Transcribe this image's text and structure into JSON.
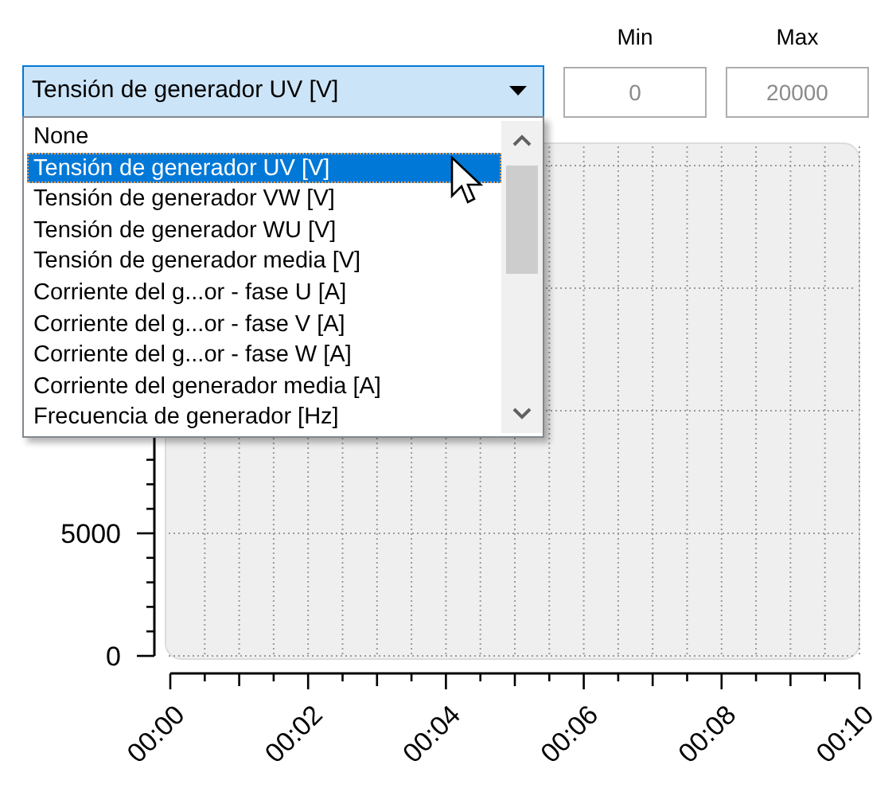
{
  "combobox": {
    "value": "Tensión de generador UV [V]",
    "expanded": true
  },
  "min": {
    "label": "Min",
    "value": "0",
    "disabled": true
  },
  "max": {
    "label": "Max",
    "value": "20000",
    "disabled": true
  },
  "dropdown_items": [
    {
      "label": "None",
      "selected": false
    },
    {
      "label": "Tensión de generador UV [V]",
      "selected": true
    },
    {
      "label": "Tensión de generador VW [V]",
      "selected": false
    },
    {
      "label": "Tensión de generador WU [V]",
      "selected": false
    },
    {
      "label": "Tensión de generador media [V]",
      "selected": false
    },
    {
      "label": "Corriente del g...or - fase U [A]",
      "selected": false
    },
    {
      "label": "Corriente del g...or - fase V [A]",
      "selected": false
    },
    {
      "label": "Corriente del g...or - fase W [A]",
      "selected": false
    },
    {
      "label": "Corriente del generador media [A]",
      "selected": false
    },
    {
      "label": "Frecuencia de generador [Hz]",
      "selected": false
    }
  ],
  "chart_data": {
    "type": "line",
    "grid": true,
    "ylim": [
      0,
      20000
    ],
    "yticks": [
      0,
      5000
    ],
    "xlim": [
      0,
      10
    ],
    "xticks": [
      {
        "value": 0,
        "label": "00:00"
      },
      {
        "value": 2,
        "label": "00:02"
      },
      {
        "value": 4,
        "label": "00:04"
      },
      {
        "value": 6,
        "label": "00:06"
      },
      {
        "value": 8,
        "label": "00:08"
      },
      {
        "value": 10,
        "label": "00:10"
      }
    ]
  }
}
